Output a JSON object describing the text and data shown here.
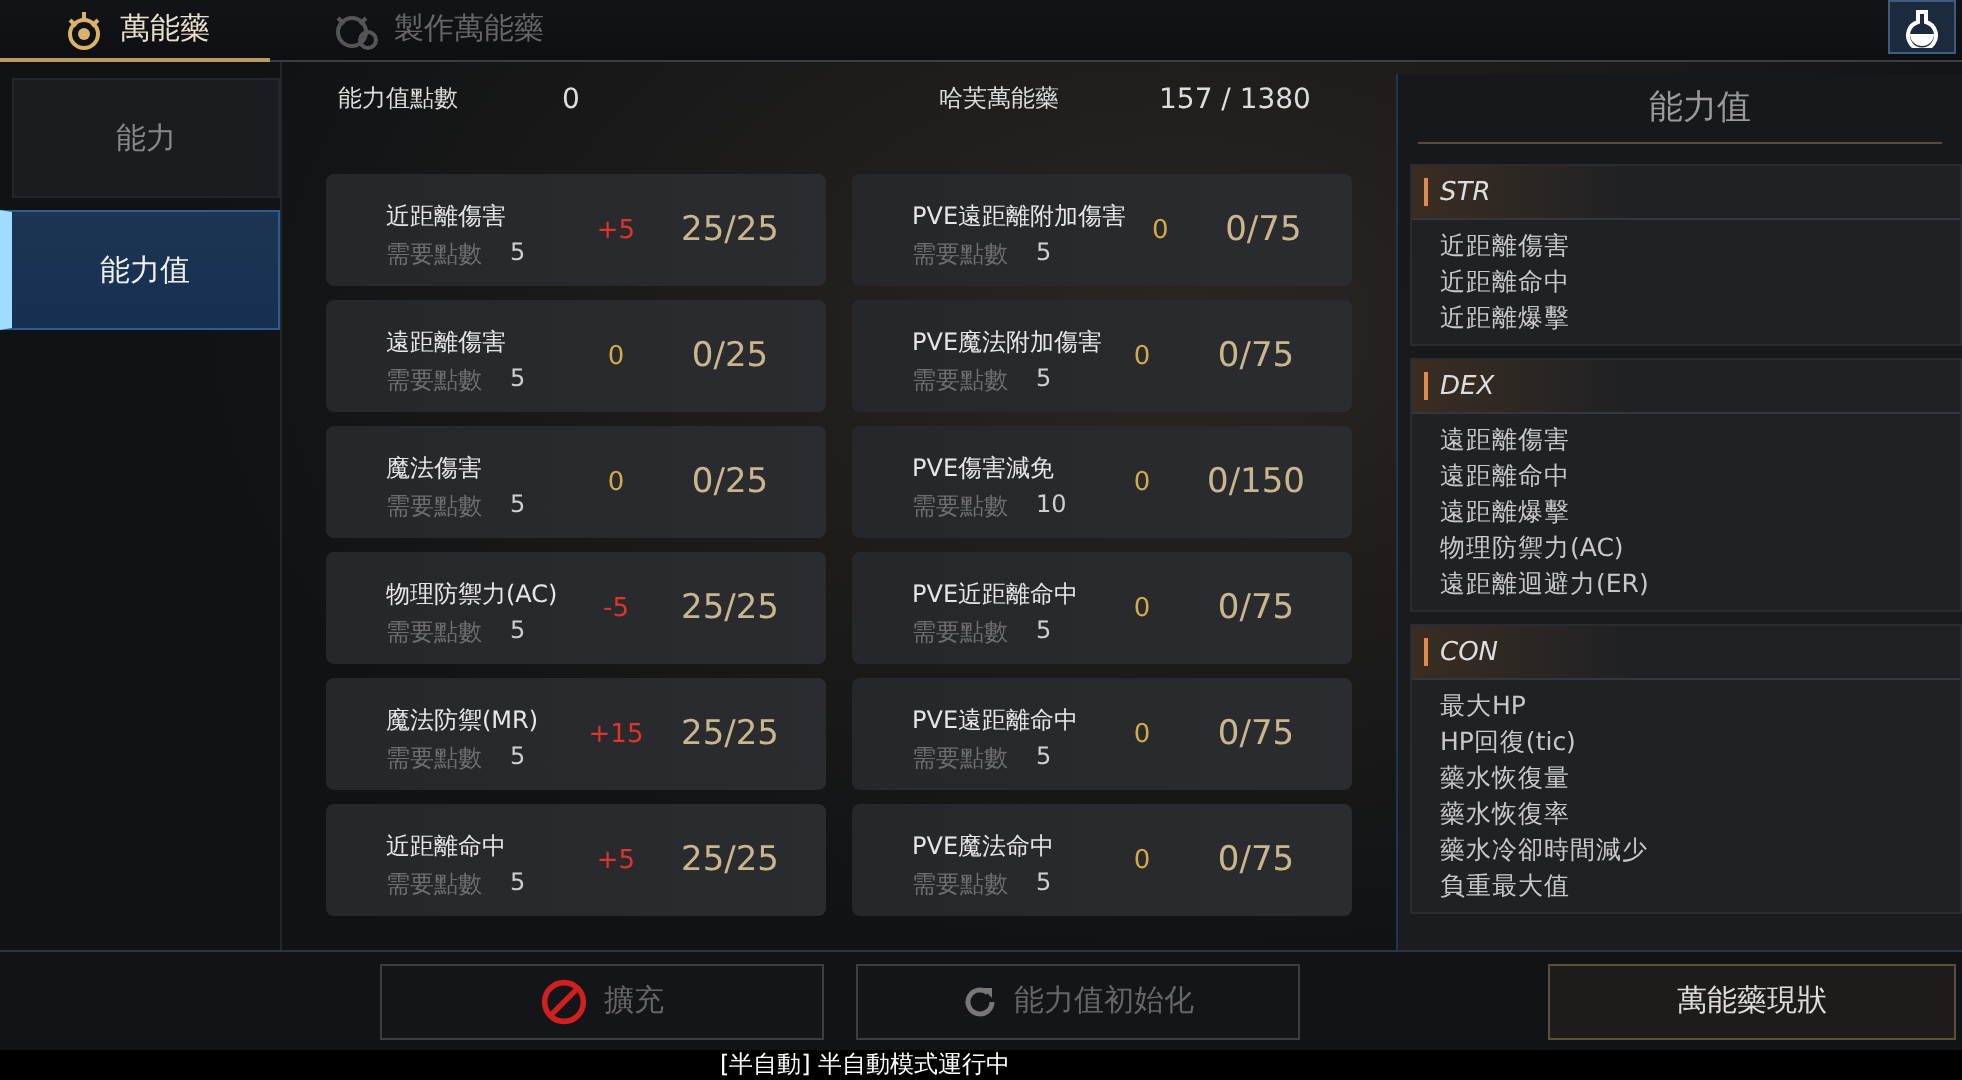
{
  "tabs": [
    {
      "label": "萬能藥",
      "selected": true
    },
    {
      "label": "製作萬能藥",
      "selected": false
    }
  ],
  "sidebar": {
    "items": [
      {
        "label": "能力",
        "selected": false
      },
      {
        "label": "能力值",
        "selected": true
      }
    ]
  },
  "summary": [
    {
      "label": "能力值點數",
      "value": "0"
    },
    {
      "label": "哈芙萬能藥",
      "value": "157 / 1380"
    }
  ],
  "stats": [
    {
      "name": "近距離傷害",
      "need_label": "需要點數",
      "need": "5",
      "delta": "+5",
      "changed": true,
      "ratio": "25/25"
    },
    {
      "name": "PVE遠距離附加傷害",
      "need_label": "需要點數",
      "need": "5",
      "delta": "0",
      "changed": false,
      "ratio": "0/75"
    },
    {
      "name": "遠距離傷害",
      "need_label": "需要點數",
      "need": "5",
      "delta": "0",
      "changed": false,
      "ratio": "0/25"
    },
    {
      "name": "PVE魔法附加傷害",
      "need_label": "需要點數",
      "need": "5",
      "delta": "0",
      "changed": false,
      "ratio": "0/75"
    },
    {
      "name": "魔法傷害",
      "need_label": "需要點數",
      "need": "5",
      "delta": "0",
      "changed": false,
      "ratio": "0/25"
    },
    {
      "name": "PVE傷害減免",
      "need_label": "需要點數",
      "need": "10",
      "delta": "0",
      "changed": false,
      "ratio": "0/150"
    },
    {
      "name": "物理防禦力(AC)",
      "need_label": "需要點數",
      "need": "5",
      "delta": "-5",
      "changed": true,
      "ratio": "25/25"
    },
    {
      "name": "PVE近距離命中",
      "need_label": "需要點數",
      "need": "5",
      "delta": "0",
      "changed": false,
      "ratio": "0/75"
    },
    {
      "name": "魔法防禦(MR)",
      "need_label": "需要點數",
      "need": "5",
      "delta": "+15",
      "changed": true,
      "ratio": "25/25"
    },
    {
      "name": "PVE遠距離命中",
      "need_label": "需要點數",
      "need": "5",
      "delta": "0",
      "changed": false,
      "ratio": "0/75"
    },
    {
      "name": "近距離命中",
      "need_label": "需要點數",
      "need": "5",
      "delta": "+5",
      "changed": true,
      "ratio": "25/25"
    },
    {
      "name": "PVE魔法命中",
      "need_label": "需要點數",
      "need": "5",
      "delta": "0",
      "changed": false,
      "ratio": "0/75"
    }
  ],
  "info_panel": {
    "title": "能力值",
    "groups": [
      {
        "name": "STR",
        "items": [
          "近距離傷害",
          "近距離命中",
          "近距離爆擊"
        ]
      },
      {
        "name": "DEX",
        "items": [
          "遠距離傷害",
          "遠距離命中",
          "遠距離爆擊",
          "物理防禦力(AC)",
          "遠距離迴避力(ER)"
        ]
      },
      {
        "name": "CON",
        "items": [
          "最大HP",
          "HP回復(tic)",
          "藥水恢復量",
          "藥水恢復率",
          "藥水冷卻時間減少",
          "負重最大值"
        ]
      }
    ]
  },
  "buttons": [
    {
      "label": "擴充",
      "disabled": true,
      "kind": "blocked"
    },
    {
      "label": "能力值初始化",
      "disabled": true,
      "kind": "reset"
    },
    {
      "label": "萬能藥現狀",
      "disabled": false,
      "kind": "plain"
    }
  ],
  "status_bar": "[半自動] 半自動模式運行中"
}
